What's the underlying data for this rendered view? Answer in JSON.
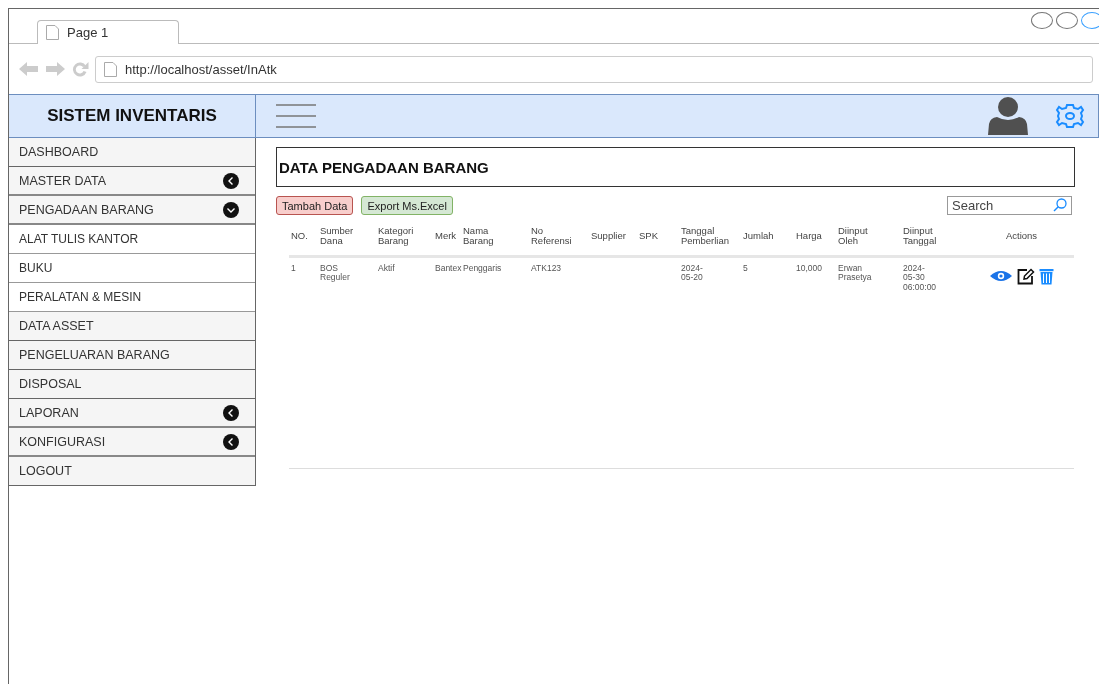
{
  "browser": {
    "tab": "Page 1",
    "url": "http://localhost/asset/InAtk"
  },
  "header": {
    "brand": "SISTEM INVENTARIS"
  },
  "sidebar": {
    "items": [
      {
        "label": "DASHBOARD",
        "kind": "link"
      },
      {
        "label": "MASTER DATA",
        "kind": "group",
        "expanded": false
      },
      {
        "label": "PENGADAAN BARANG",
        "kind": "group",
        "expanded": true,
        "children": [
          {
            "label": "ALAT TULIS KANTOR"
          },
          {
            "label": "BUKU"
          },
          {
            "label": "PERALATAN & MESIN"
          }
        ]
      },
      {
        "label": "DATA ASSET",
        "kind": "link"
      },
      {
        "label": "PENGELUARAN BARANG",
        "kind": "link"
      },
      {
        "label": "DISPOSAL",
        "kind": "link"
      },
      {
        "label": "LAPORAN",
        "kind": "group",
        "expanded": false
      },
      {
        "label": "KONFIGURASI",
        "kind": "group",
        "expanded": false
      },
      {
        "label": "LOGOUT",
        "kind": "link"
      }
    ]
  },
  "content": {
    "title": "DATA PENGADAAN BARANG",
    "buttons": [
      {
        "label": "Tambah Data",
        "kind": "add"
      },
      {
        "label": "Export Ms.Excel",
        "kind": "export"
      }
    ],
    "search": {
      "placeholder": "Search"
    },
    "table": {
      "columns": [
        "NO.",
        "Sumber Dana",
        "Kategori Barang",
        "Merk",
        "Nama Barang",
        "No Referensi",
        "Supplier",
        "SPK",
        "Tanggal Pemberlian",
        "Jumlah",
        "Harga",
        "Diinput Oleh",
        "Diinput Tanggal",
        "Actions"
      ],
      "rows": [
        {
          "cells": [
            "1",
            "BOS Reguler",
            "Aktif",
            "Bantex",
            "Penggaris",
            "ATK123",
            "",
            "",
            "2024-05-20",
            "5",
            "10,000",
            "Erwan Prasetya",
            "2024-05-30 06:00:00"
          ]
        }
      ]
    }
  }
}
